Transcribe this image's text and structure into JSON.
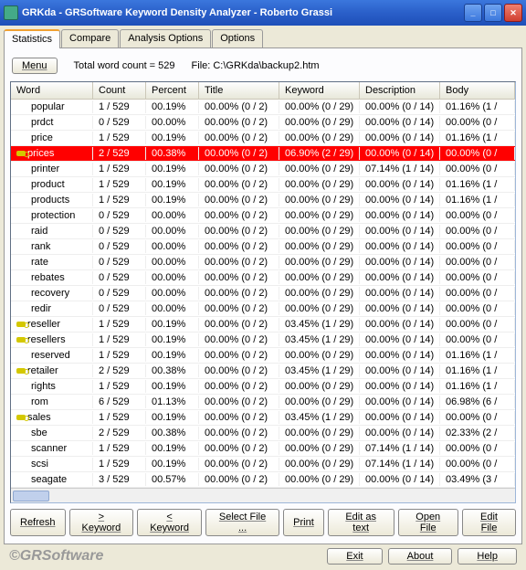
{
  "title": "GRKda - GRSoftware Keyword Density Analyzer - Roberto Grassi",
  "tabs": [
    "Statistics",
    "Compare",
    "Analysis Options",
    "Options"
  ],
  "menuLabel": "Menu",
  "wordCountLabel": "Total word count =  529",
  "fileLabel": "File: C:\\GRKda\\backup2.htm",
  "columns": [
    "Word",
    "Count",
    "Percent",
    "Title",
    "Keyword",
    "Description",
    "Body"
  ],
  "rows": [
    {
      "word": "popular",
      "count": "1 / 529",
      "percent": "00.19%",
      "title": "00.00% (0 / 2)",
      "keyword": "00.00% (0 / 29)",
      "desc": "00.00% (0 / 14)",
      "body": "01.16% (1 /",
      "key": false,
      "hl": false
    },
    {
      "word": "prdct",
      "count": "0 / 529",
      "percent": "00.00%",
      "title": "00.00% (0 / 2)",
      "keyword": "00.00% (0 / 29)",
      "desc": "00.00% (0 / 14)",
      "body": "00.00% (0 /",
      "key": false,
      "hl": false
    },
    {
      "word": "price",
      "count": "1 / 529",
      "percent": "00.19%",
      "title": "00.00% (0 / 2)",
      "keyword": "00.00% (0 / 29)",
      "desc": "00.00% (0 / 14)",
      "body": "01.16% (1 /",
      "key": false,
      "hl": false
    },
    {
      "word": "prices",
      "count": "2 / 529",
      "percent": "00.38%",
      "title": "00.00% (0 / 2)",
      "keyword": "06.90% (2 / 29)",
      "desc": "00.00% (0 / 14)",
      "body": "00.00% (0 /",
      "key": true,
      "hl": true
    },
    {
      "word": "printer",
      "count": "1 / 529",
      "percent": "00.19%",
      "title": "00.00% (0 / 2)",
      "keyword": "00.00% (0 / 29)",
      "desc": "07.14% (1 / 14)",
      "body": "00.00% (0 /",
      "key": false,
      "hl": false
    },
    {
      "word": "product",
      "count": "1 / 529",
      "percent": "00.19%",
      "title": "00.00% (0 / 2)",
      "keyword": "00.00% (0 / 29)",
      "desc": "00.00% (0 / 14)",
      "body": "01.16% (1 /",
      "key": false,
      "hl": false
    },
    {
      "word": "products",
      "count": "1 / 529",
      "percent": "00.19%",
      "title": "00.00% (0 / 2)",
      "keyword": "00.00% (0 / 29)",
      "desc": "00.00% (0 / 14)",
      "body": "01.16% (1 /",
      "key": false,
      "hl": false
    },
    {
      "word": "protection",
      "count": "0 / 529",
      "percent": "00.00%",
      "title": "00.00% (0 / 2)",
      "keyword": "00.00% (0 / 29)",
      "desc": "00.00% (0 / 14)",
      "body": "00.00% (0 /",
      "key": false,
      "hl": false
    },
    {
      "word": "raid",
      "count": "0 / 529",
      "percent": "00.00%",
      "title": "00.00% (0 / 2)",
      "keyword": "00.00% (0 / 29)",
      "desc": "00.00% (0 / 14)",
      "body": "00.00% (0 /",
      "key": false,
      "hl": false
    },
    {
      "word": "rank",
      "count": "0 / 529",
      "percent": "00.00%",
      "title": "00.00% (0 / 2)",
      "keyword": "00.00% (0 / 29)",
      "desc": "00.00% (0 / 14)",
      "body": "00.00% (0 /",
      "key": false,
      "hl": false
    },
    {
      "word": "rate",
      "count": "0 / 529",
      "percent": "00.00%",
      "title": "00.00% (0 / 2)",
      "keyword": "00.00% (0 / 29)",
      "desc": "00.00% (0 / 14)",
      "body": "00.00% (0 /",
      "key": false,
      "hl": false
    },
    {
      "word": "rebates",
      "count": "0 / 529",
      "percent": "00.00%",
      "title": "00.00% (0 / 2)",
      "keyword": "00.00% (0 / 29)",
      "desc": "00.00% (0 / 14)",
      "body": "00.00% (0 /",
      "key": false,
      "hl": false
    },
    {
      "word": "recovery",
      "count": "0 / 529",
      "percent": "00.00%",
      "title": "00.00% (0 / 2)",
      "keyword": "00.00% (0 / 29)",
      "desc": "00.00% (0 / 14)",
      "body": "00.00% (0 /",
      "key": false,
      "hl": false
    },
    {
      "word": "redir",
      "count": "0 / 529",
      "percent": "00.00%",
      "title": "00.00% (0 / 2)",
      "keyword": "00.00% (0 / 29)",
      "desc": "00.00% (0 / 14)",
      "body": "00.00% (0 /",
      "key": false,
      "hl": false
    },
    {
      "word": "reseller",
      "count": "1 / 529",
      "percent": "00.19%",
      "title": "00.00% (0 / 2)",
      "keyword": "03.45% (1 / 29)",
      "desc": "00.00% (0 / 14)",
      "body": "00.00% (0 /",
      "key": true,
      "hl": false
    },
    {
      "word": "resellers",
      "count": "1 / 529",
      "percent": "00.19%",
      "title": "00.00% (0 / 2)",
      "keyword": "03.45% (1 / 29)",
      "desc": "00.00% (0 / 14)",
      "body": "00.00% (0 /",
      "key": true,
      "hl": false
    },
    {
      "word": "reserved",
      "count": "1 / 529",
      "percent": "00.19%",
      "title": "00.00% (0 / 2)",
      "keyword": "00.00% (0 / 29)",
      "desc": "00.00% (0 / 14)",
      "body": "01.16% (1 /",
      "key": false,
      "hl": false
    },
    {
      "word": "retailer",
      "count": "2 / 529",
      "percent": "00.38%",
      "title": "00.00% (0 / 2)",
      "keyword": "03.45% (1 / 29)",
      "desc": "00.00% (0 / 14)",
      "body": "01.16% (1 /",
      "key": true,
      "hl": false
    },
    {
      "word": "rights",
      "count": "1 / 529",
      "percent": "00.19%",
      "title": "00.00% (0 / 2)",
      "keyword": "00.00% (0 / 29)",
      "desc": "00.00% (0 / 14)",
      "body": "01.16% (1 /",
      "key": false,
      "hl": false
    },
    {
      "word": "rom",
      "count": "6 / 529",
      "percent": "01.13%",
      "title": "00.00% (0 / 2)",
      "keyword": "00.00% (0 / 29)",
      "desc": "00.00% (0 / 14)",
      "body": "06.98% (6 /",
      "key": false,
      "hl": false
    },
    {
      "word": "sales",
      "count": "1 / 529",
      "percent": "00.19%",
      "title": "00.00% (0 / 2)",
      "keyword": "03.45% (1 / 29)",
      "desc": "00.00% (0 / 14)",
      "body": "00.00% (0 /",
      "key": true,
      "hl": false
    },
    {
      "word": "sbe",
      "count": "2 / 529",
      "percent": "00.38%",
      "title": "00.00% (0 / 2)",
      "keyword": "00.00% (0 / 29)",
      "desc": "00.00% (0 / 14)",
      "body": "02.33% (2 /",
      "key": false,
      "hl": false
    },
    {
      "word": "scanner",
      "count": "1 / 529",
      "percent": "00.19%",
      "title": "00.00% (0 / 2)",
      "keyword": "00.00% (0 / 29)",
      "desc": "07.14% (1 / 14)",
      "body": "00.00% (0 /",
      "key": false,
      "hl": false
    },
    {
      "word": "scsi",
      "count": "1 / 529",
      "percent": "00.19%",
      "title": "00.00% (0 / 2)",
      "keyword": "00.00% (0 / 29)",
      "desc": "07.14% (1 / 14)",
      "body": "00.00% (0 /",
      "key": false,
      "hl": false
    },
    {
      "word": "seagate",
      "count": "3 / 529",
      "percent": "00.57%",
      "title": "00.00% (0 / 2)",
      "keyword": "00.00% (0 / 29)",
      "desc": "00.00% (0 / 14)",
      "body": "03.49% (3 /",
      "key": false,
      "hl": false
    }
  ],
  "buttons": {
    "refresh": "Refresh",
    "kwNext": "> Keyword",
    "kwPrev": "< Keyword",
    "selectFile": "Select File ...",
    "print": "Print",
    "editText": "Edit as text",
    "openFile": "Open File",
    "editFile": "Edit File",
    "exit": "Exit",
    "about": "About",
    "help": "Help"
  },
  "brand": "©GRSoftware"
}
